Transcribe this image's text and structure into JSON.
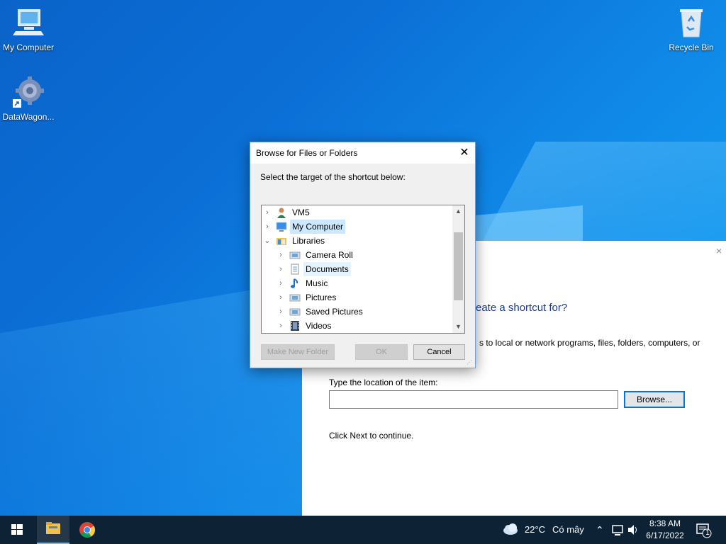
{
  "desktop": {
    "icons": [
      {
        "label": "My Computer"
      },
      {
        "label": "DataWagon..."
      },
      {
        "label": "Recycle Bin"
      }
    ]
  },
  "wizard": {
    "heading": "reate a shortcut for?",
    "description": "s to local or network programs, files, folders, computers, or",
    "location_label": "Type the location of the item:",
    "location_value": "",
    "browse_label": "Browse...",
    "next_hint": "Click Next to continue.",
    "close_glyph": "×"
  },
  "dialog": {
    "title": "Browse for Files or Folders",
    "close_glyph": "✕",
    "instruction": "Select the target of the shortcut below:",
    "tree": [
      {
        "label": "VM5",
        "icon": "user-icon",
        "expanded": false,
        "level": 0
      },
      {
        "label": "My Computer",
        "icon": "computer-icon",
        "expanded": false,
        "level": 0,
        "selected": true
      },
      {
        "label": "Libraries",
        "icon": "libraries-icon",
        "expanded": true,
        "level": 0
      },
      {
        "label": "Camera Roll",
        "icon": "library-folder-icon",
        "expanded": false,
        "level": 1
      },
      {
        "label": "Documents",
        "icon": "documents-icon",
        "expanded": false,
        "level": 1,
        "hover": true
      },
      {
        "label": "Music",
        "icon": "music-icon",
        "expanded": false,
        "level": 1
      },
      {
        "label": "Pictures",
        "icon": "library-folder-icon",
        "expanded": false,
        "level": 1
      },
      {
        "label": "Saved Pictures",
        "icon": "library-folder-icon",
        "expanded": false,
        "level": 1
      },
      {
        "label": "Videos",
        "icon": "videos-icon",
        "expanded": false,
        "level": 1
      }
    ],
    "buttons": {
      "new_folder": "Make New Folder",
      "ok": "OK",
      "cancel": "Cancel"
    }
  },
  "taskbar": {
    "weather_temp": "22°C",
    "weather_text": "Có mây",
    "time": "8:38 AM",
    "date": "6/17/2022",
    "notification_count": "1"
  }
}
